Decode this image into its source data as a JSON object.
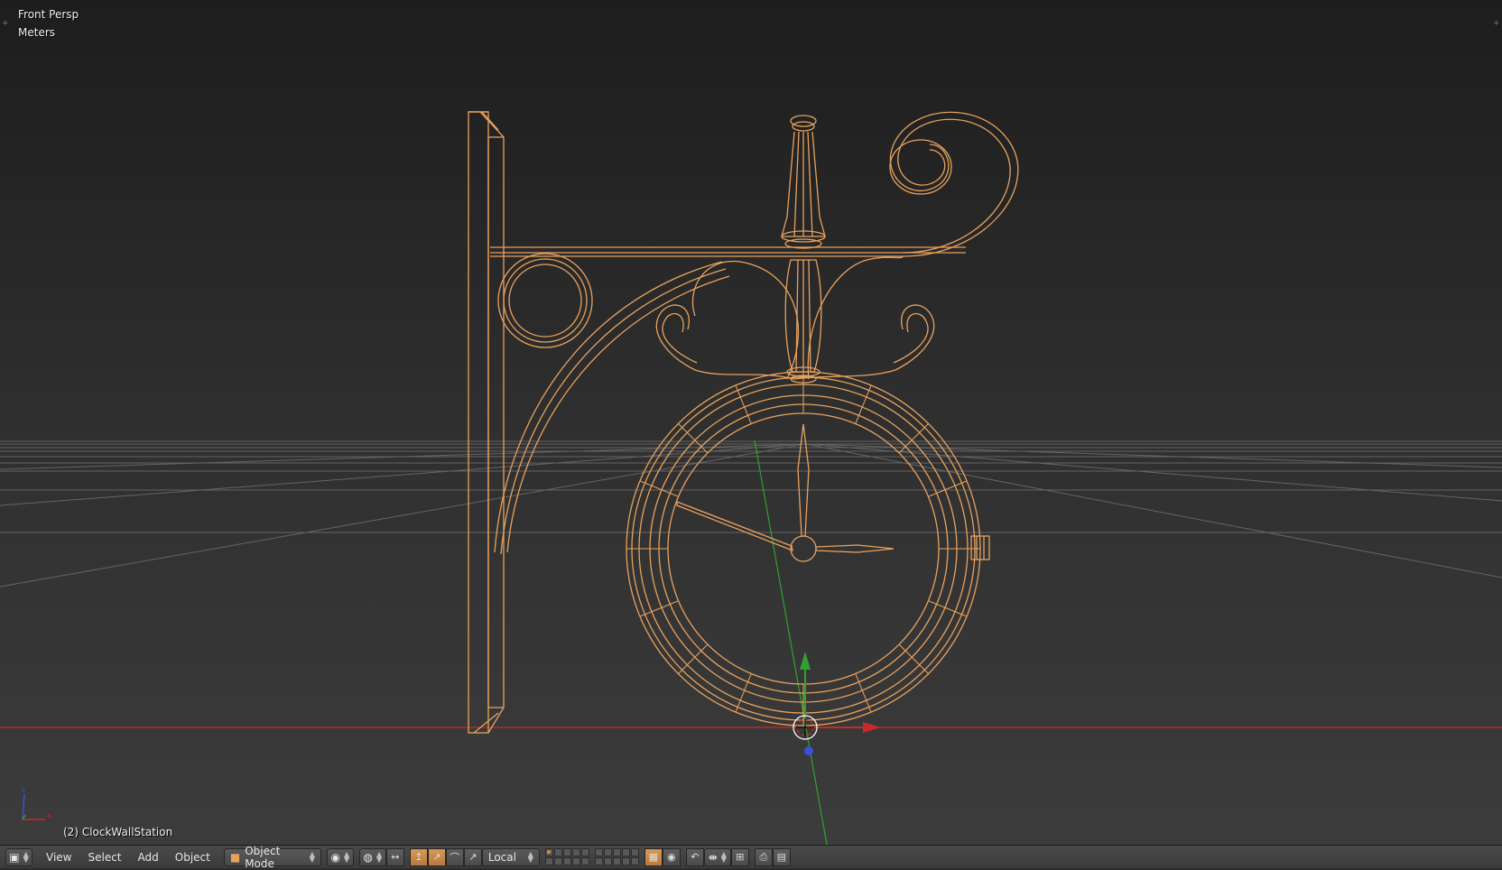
{
  "viewport": {
    "view_name": "Front Persp",
    "units": "Meters",
    "object_name": "(2) ClockWallStation",
    "wire_color": "#e8a25f",
    "background_top": "#1d1d1d",
    "background_bottom": "#3c3c3c",
    "grid_color": "#6e6e6e",
    "x_axis_color": "#c62a2a",
    "y_axis_color": "#2fa22f",
    "z_axis_color": "#3b4fd9"
  },
  "header": {
    "editor_type_icon": "view3d-icon",
    "menus": {
      "view": "View",
      "select": "Select",
      "add": "Add",
      "object": "Object"
    },
    "mode": {
      "icon": "object-cube-icon",
      "label": "Object Mode"
    },
    "shading_icon": "viewport-shading-icon",
    "pivot_icon": "pivot-point-icon",
    "manipulator_icons": [
      "manipulator-toggle-icon",
      "translate-icon",
      "rotate-icon",
      "scale-icon"
    ],
    "orientation": "Local",
    "layer_icon": "layers-icon",
    "snap_icons": [
      "lock-camera-icon",
      "proportional-edit-icon",
      "snap-icon",
      "snap-target-icon"
    ],
    "render_icons": [
      "render-opengl-icon",
      "render-animation-icon"
    ]
  }
}
